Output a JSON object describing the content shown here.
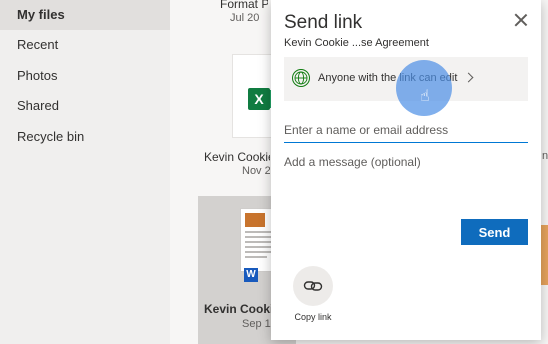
{
  "nav": {
    "items": [
      {
        "label": "My files",
        "active": true
      },
      {
        "label": "Recent"
      },
      {
        "label": "Photos"
      },
      {
        "label": "Shared"
      },
      {
        "label": "Recycle bin"
      }
    ]
  },
  "files": {
    "tile1": {
      "name": "Format Pa",
      "date": "Jul 20"
    },
    "tile2": {
      "name": "Kevin Cookie",
      "date": "Nov 2",
      "icon": "excel-icon"
    },
    "tile3": {
      "name": "Kevin Cookie",
      "date": "Sep 1",
      "icon": "word-icon"
    },
    "right_clip": "n"
  },
  "dialog": {
    "title": "Send link",
    "filename": "Kevin Cookie ...se Agreement",
    "permission_text": "Anyone with the link can edit",
    "name_placeholder": "Enter a name or email address",
    "message_placeholder": "Add a message (optional)",
    "send_label": "Send",
    "copy_label": "Copy link"
  },
  "colors": {
    "accent": "#0f6cbd",
    "excel": "#107c41",
    "word": "#185abd"
  }
}
